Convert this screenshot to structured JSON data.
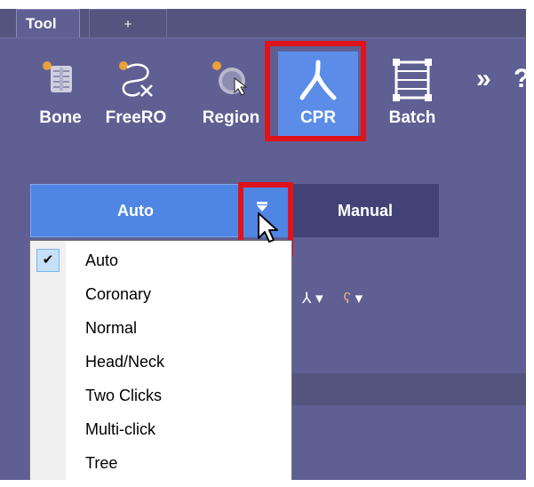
{
  "tabs": [
    {
      "label": "Tool"
    },
    {
      "label": "+"
    }
  ],
  "tools": [
    {
      "label": "Bone",
      "icon": "bone-icon"
    },
    {
      "label": "FreeRO",
      "icon": "freero-icon"
    },
    {
      "label": "Region",
      "icon": "region-icon"
    },
    {
      "label": "CPR",
      "icon": "cpr-icon",
      "selected": true
    },
    {
      "label": "Batch",
      "icon": "batch-icon"
    }
  ],
  "toolbar": {
    "more_label": "»",
    "help_label": "?"
  },
  "modes": {
    "auto_label": "Auto",
    "manual_label": "Manual"
  },
  "menu": {
    "items": [
      {
        "label": "Auto",
        "checked": true
      },
      {
        "label": "Coronary"
      },
      {
        "label": "Normal"
      },
      {
        "label": "Head/Neck"
      },
      {
        "label": "Two Clicks"
      },
      {
        "label": "Multi-click"
      },
      {
        "label": "Tree"
      }
    ],
    "check_glyph": "✔"
  },
  "colors": {
    "background": "#5f5f93",
    "cpr_active": "#5b8de8",
    "highlight": "#e0131a",
    "manual": "#424277"
  }
}
